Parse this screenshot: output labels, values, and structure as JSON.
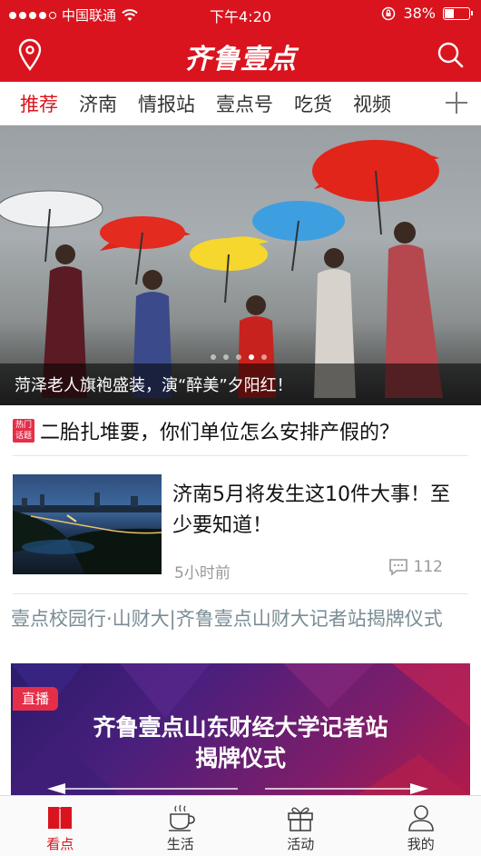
{
  "status_bar": {
    "carrier": "中国联通",
    "time": "下午4:20",
    "battery": "38%",
    "battery_level": 0.38
  },
  "header": {
    "logo": "齐鲁壹点"
  },
  "channels": {
    "items": [
      "推荐",
      "济南",
      "情报站",
      "壹点号",
      "吃货",
      "视频"
    ],
    "active_index": 0
  },
  "hero": {
    "caption": "菏泽老人旗袍盛装，演“醉美”夕阳红！",
    "slide_count": 5,
    "current_slide": 3
  },
  "hot": {
    "badge_line1": "热门",
    "badge_line2": "话题",
    "title": "二胎扎堆要，你们单位怎么安排产假的？"
  },
  "article": {
    "title": "济南5月将发生这10件大事！至少要知道！",
    "time": "5小时前",
    "comments": "112"
  },
  "live": {
    "title": "壹点校园行·山财大|齐鲁壹点山财大记者站揭牌仪式",
    "badge": "直播",
    "banner_line1": "齐鲁壹点山东财经大学记者站",
    "banner_line2": "揭牌仪式"
  },
  "tabbar": {
    "items": [
      "看点",
      "生活",
      "活动",
      "我的"
    ],
    "active_index": 0
  },
  "colors": {
    "brand_red": "#d9141e",
    "badge_pink": "#e52e48"
  }
}
